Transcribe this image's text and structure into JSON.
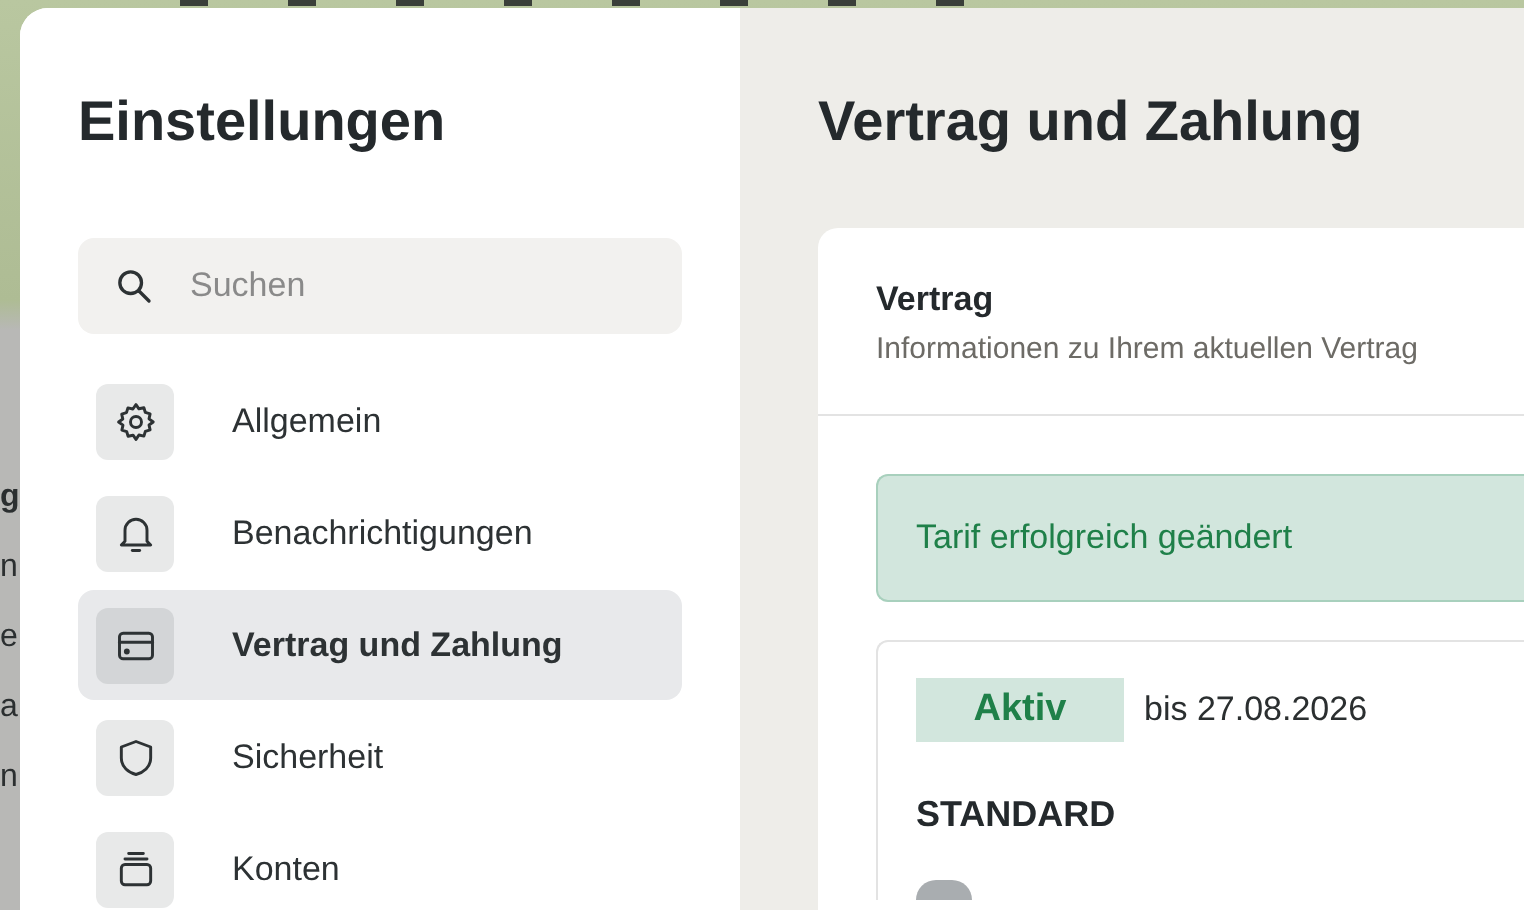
{
  "background_fragments": [
    {
      "text": "g",
      "bold": true
    },
    {
      "text": "n",
      "bold": false
    },
    {
      "text": "e",
      "bold": false
    },
    {
      "text": "a",
      "bold": false
    },
    {
      "text": "n",
      "bold": false
    }
  ],
  "sidebar": {
    "title": "Einstellungen",
    "search": {
      "placeholder": "Suchen"
    },
    "items": [
      {
        "kind": "general",
        "label": "Allgemein",
        "selected": false
      },
      {
        "kind": "notifications",
        "label": "Benachrichtigungen",
        "selected": false
      },
      {
        "kind": "payment",
        "label": "Vertrag und Zahlung",
        "selected": true
      },
      {
        "kind": "security",
        "label": "Sicherheit",
        "selected": false
      },
      {
        "kind": "accounts",
        "label": "Konten",
        "selected": false
      }
    ]
  },
  "main": {
    "title": "Vertrag und Zahlung",
    "card": {
      "title": "Vertrag",
      "subtitle": "Informationen zu Ihrem aktuellen Vertrag",
      "alert": "Tarif erfolgreich geändert",
      "plan": {
        "status": "Aktiv",
        "until": "bis 27.08.2026",
        "name": "STANDARD"
      }
    }
  }
}
